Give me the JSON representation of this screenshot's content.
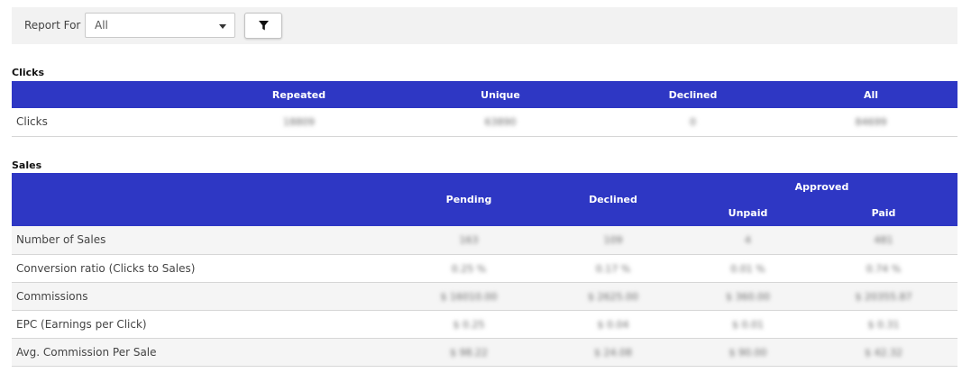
{
  "filter": {
    "label": "Report For",
    "select_value": "All",
    "filter_icon": "filter-icon"
  },
  "clicks": {
    "title": "Clicks",
    "columns": [
      "",
      "Repeated",
      "Unique",
      "Declined",
      "All"
    ],
    "row": {
      "label": "Clicks",
      "values": [
        "18809",
        "63890",
        "0",
        "84699"
      ]
    }
  },
  "sales": {
    "title": "Sales",
    "headers": {
      "pending": "Pending",
      "declined": "Declined",
      "approved": "Approved",
      "unpaid": "Unpaid",
      "paid": "Paid"
    },
    "rows": [
      {
        "label": "Number of Sales",
        "values": [
          "163",
          "109",
          "4",
          "481"
        ]
      },
      {
        "label": "Conversion ratio (Clicks to Sales)",
        "values": [
          "0.25 %",
          "0.17 %",
          "0.01 %",
          "0.74 %"
        ]
      },
      {
        "label": "Commissions",
        "values": [
          "$ 16010.00",
          "$ 2625.00",
          "$ 360.00",
          "$ 20355.87"
        ]
      },
      {
        "label": "EPC (Earnings per Click)",
        "values": [
          "$ 0.25",
          "$ 0.04",
          "$ 0.01",
          "$ 0.31"
        ]
      },
      {
        "label": "Avg. Commission Per Sale",
        "values": [
          "$ 98.22",
          "$ 24.08",
          "$ 90.00",
          "$ 42.32"
        ]
      }
    ]
  }
}
